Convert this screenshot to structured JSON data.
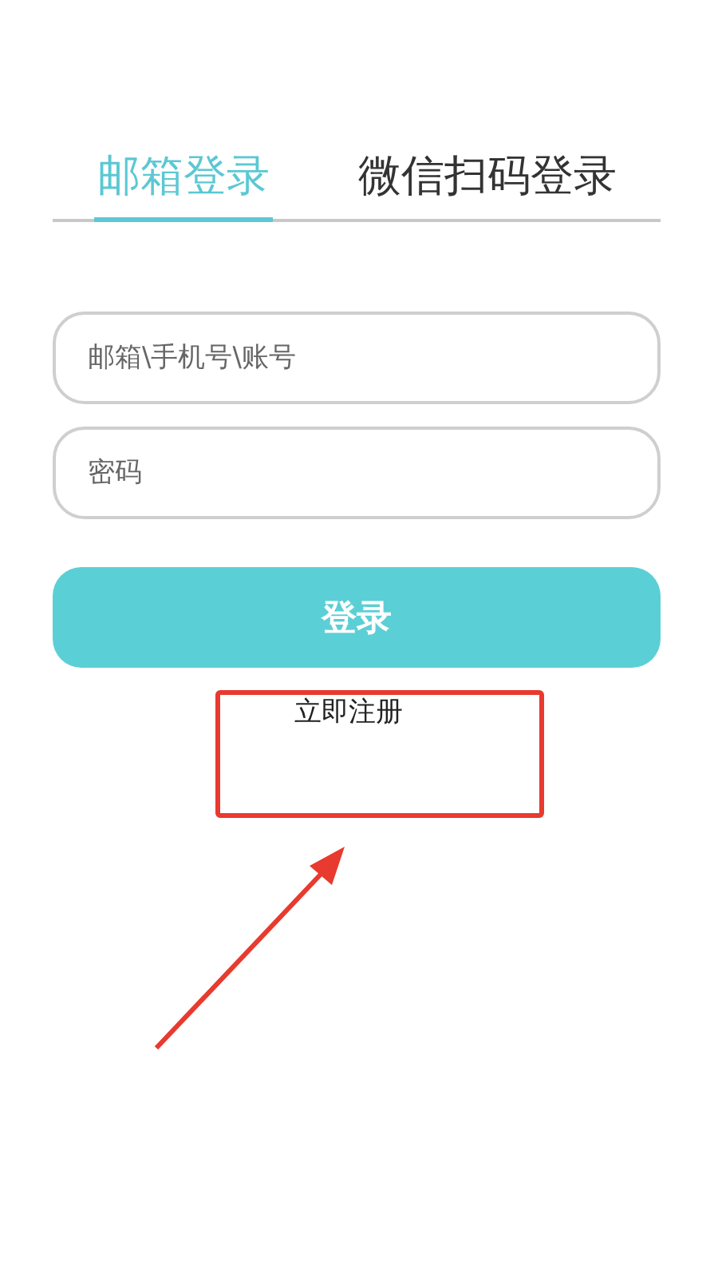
{
  "tabs": [
    {
      "label": "邮箱登录",
      "selected": true
    },
    {
      "label": "微信扫码登录",
      "selected": false
    }
  ],
  "fields": [
    {
      "placeholder": "邮箱\\手机号\\账号"
    },
    {
      "placeholder": "密码"
    }
  ],
  "login_button": "登录",
  "register_link": "立即注册"
}
